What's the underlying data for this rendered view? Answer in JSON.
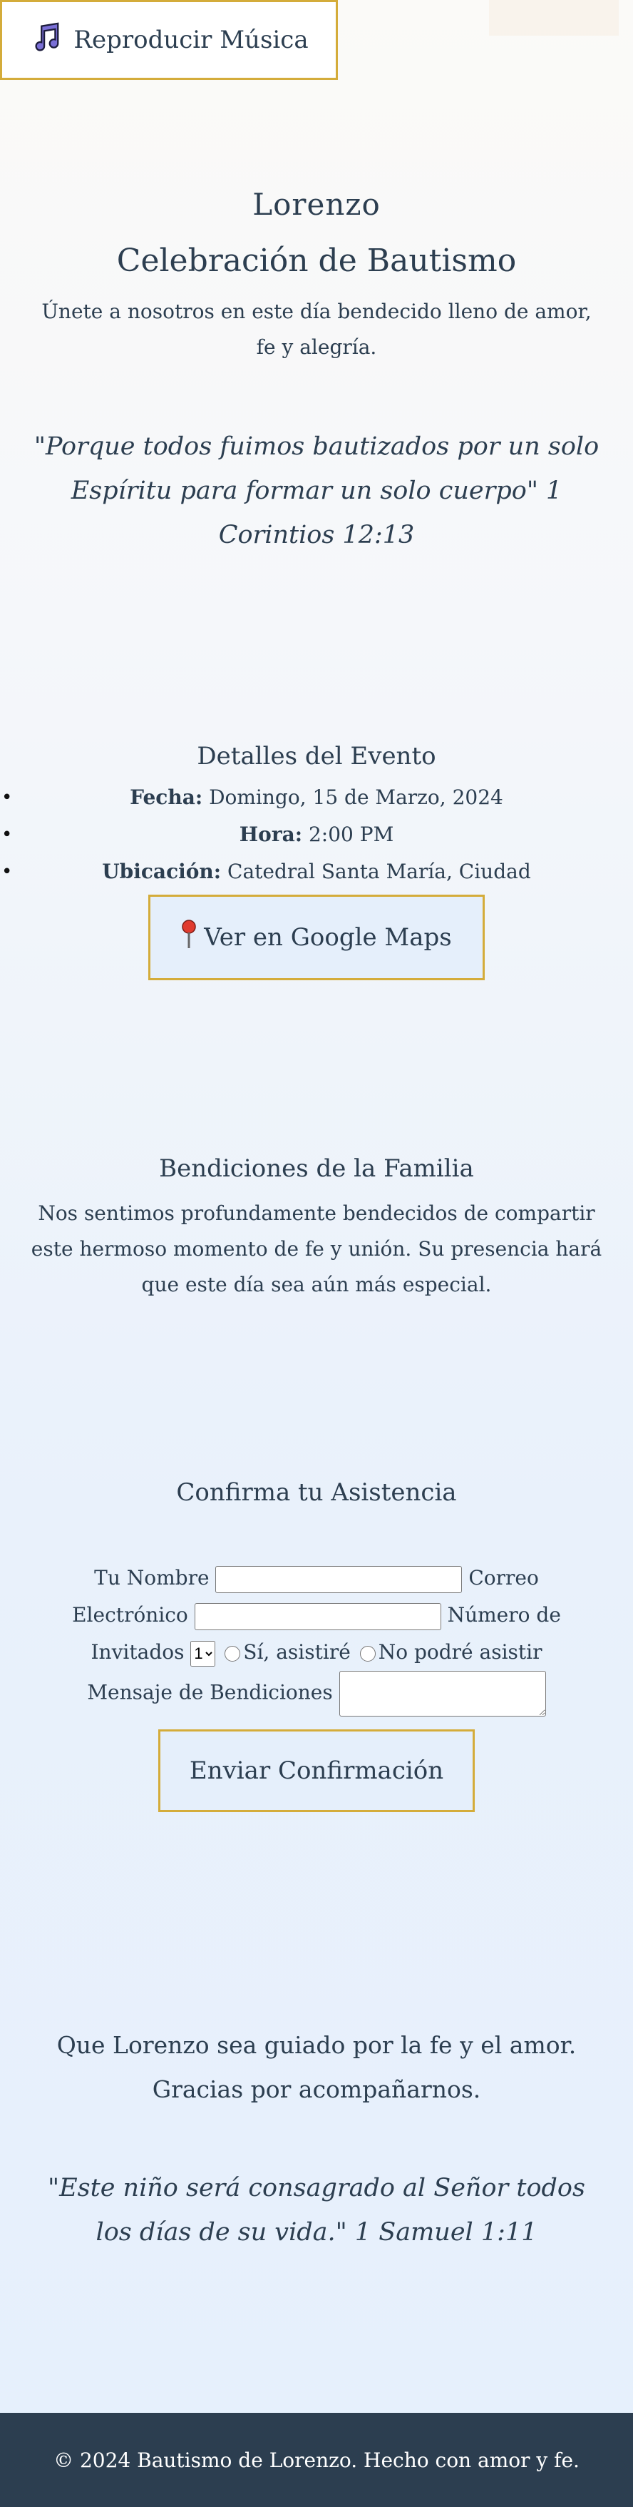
{
  "music_button": {
    "label": "Reproducir Música",
    "icon": "music-note-icon"
  },
  "header": {
    "name": "Lorenzo",
    "title": "Celebración de Bautismo",
    "intro": "Únete a nosotros en este día bendecido lleno de amor, fe y alegría."
  },
  "verse1": "\"Porque todos fuimos bautizados por un solo Espíritu para formar un solo cuerpo\" 1 Corintios 12:13",
  "details": {
    "title": "Detalles del Evento",
    "items": [
      {
        "label": "Fecha:",
        "value": "Domingo, 15 de Marzo, 2024"
      },
      {
        "label": "Hora:",
        "value": "2:00 PM"
      },
      {
        "label": "Ubicación:",
        "value": "Catedral Santa María, Ciudad"
      }
    ],
    "maps_button": "Ver en Google Maps",
    "maps_icon": "map-pin-icon"
  },
  "blessings": {
    "title": "Bendiciones de la Familia",
    "text": "Nos sentimos profundamente bendecidos de compartir este hermoso momento de fe y unión. Su presencia hará que este día sea aún más especial."
  },
  "rsvp": {
    "title": "Confirma tu Asistencia",
    "name_label": "Tu Nombre",
    "email_label": "Correo Electrónico",
    "guests_label": "Número de Invitados",
    "guests_selected": "1",
    "attend_yes": "Sí, asistiré",
    "attend_no": "No podré asistir",
    "message_label": "Mensaje de Bendiciones",
    "submit": "Enviar Confirmación"
  },
  "closing": "Que Lorenzo sea guiado por la fe y el amor. Gracias por acompañarnos.",
  "verse2": "\"Este niño será consagrado al Señor todos los días de su vida.\" 1 Samuel 1:11",
  "footer": "© 2024 Bautismo de Lorenzo. Hecho con amor y fe.",
  "colors": {
    "accent_gold": "#d4ac3a",
    "footer_bg": "#2c3e50",
    "text": "#2c3e50",
    "button_bg": "#e5effb"
  }
}
